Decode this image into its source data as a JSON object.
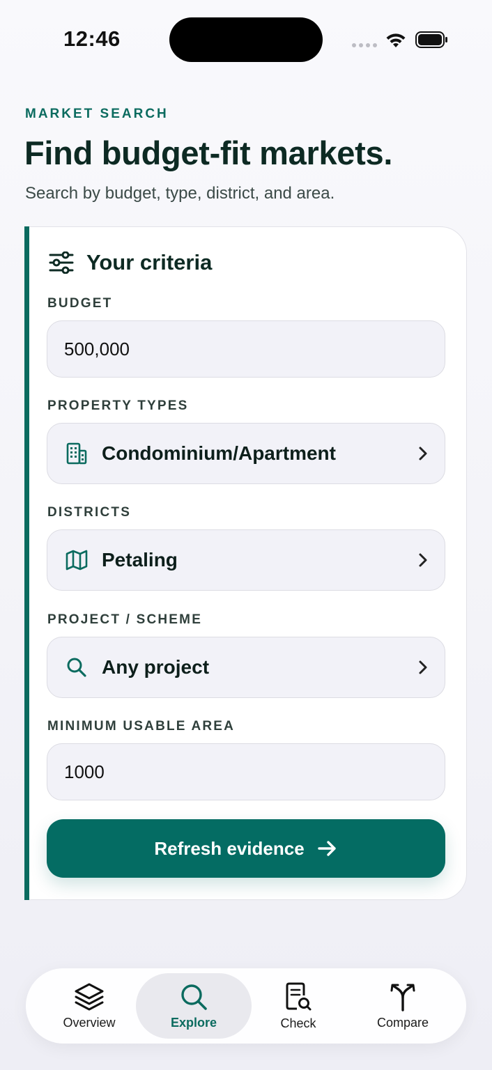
{
  "status_bar": {
    "time": "12:46"
  },
  "header": {
    "eyebrow": "MARKET SEARCH",
    "title": "Find budget-fit markets.",
    "subtitle": "Search by budget, type, district, and area."
  },
  "criteria": {
    "title": "Your criteria",
    "budget": {
      "label": "BUDGET",
      "value": "500,000"
    },
    "property_types": {
      "label": "PROPERTY TYPES",
      "value": "Condominium/Apartment",
      "icon": "building-icon"
    },
    "districts": {
      "label": "DISTRICTS",
      "value": "Petaling",
      "icon": "map-icon"
    },
    "project": {
      "label": "PROJECT / SCHEME",
      "value": "Any project",
      "icon": "search-icon"
    },
    "min_area": {
      "label": "MINIMUM USABLE AREA",
      "value": "1000"
    },
    "submit_label": "Refresh evidence"
  },
  "tabs": [
    {
      "label": "Overview",
      "icon": "stack-icon"
    },
    {
      "label": "Explore",
      "icon": "search-icon"
    },
    {
      "label": "Check",
      "icon": "document-search-icon"
    },
    {
      "label": "Compare",
      "icon": "fork-icon"
    }
  ],
  "colors": {
    "accent": "#046c63",
    "text": "#0d2a23"
  }
}
